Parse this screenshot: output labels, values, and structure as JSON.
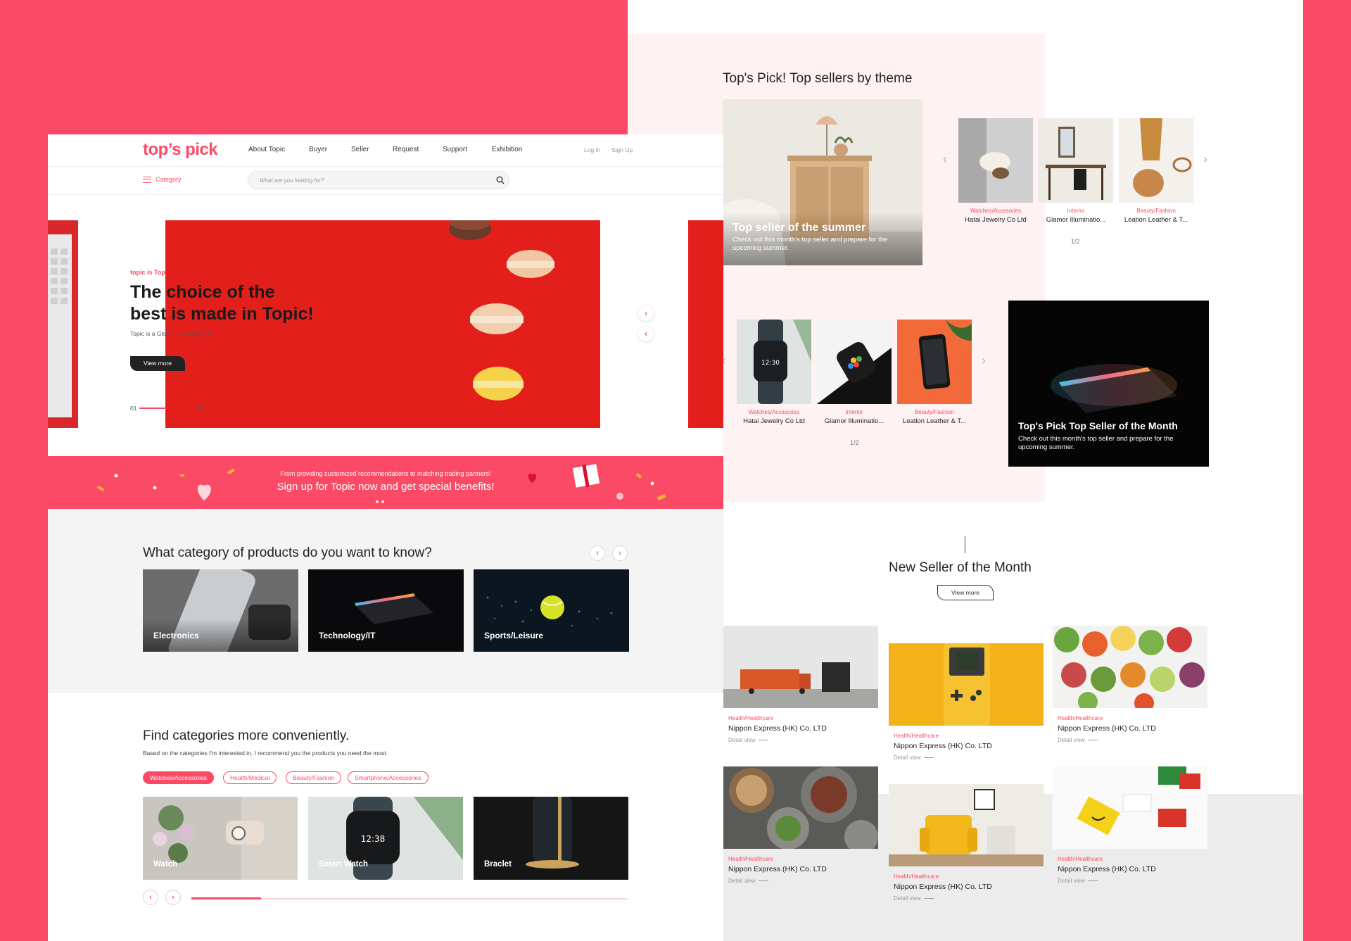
{
  "brand": {
    "logo": "top’s pick",
    "accent": "#fb4a65"
  },
  "header": {
    "nav": [
      "About Topic",
      "Buyer",
      "Seller",
      "Request",
      "Support",
      "Exhibition"
    ],
    "login": "Log in",
    "signup": "Sign Up"
  },
  "subbar": {
    "category": "Category",
    "search_placeholder": "What are you looking for?"
  },
  "hero": {
    "kicker": "topic is Top",
    "headline_1": "The choice of the",
    "headline_2": "best is made in Topic!",
    "desc": "Topic is a Glob… providing one…",
    "button": "View more",
    "page_current": "01",
    "page_total": "03"
  },
  "promo": {
    "subtitle": "From providing customized recommendations to matching trading partners!",
    "title": "Sign up for Topic now and get special benefits!"
  },
  "categories": {
    "title": "What category of products do you want to know?",
    "items": [
      "Electronics",
      "Technology/IT",
      "Sports/Leisure"
    ]
  },
  "find": {
    "title": "Find categories more conveniently.",
    "desc": "Based on the categories I'm interested in, I recommend you the products you need the most.",
    "tabs": [
      "Watches/Accessories",
      "Health/Medical",
      "Beauty/Fashion",
      "Smartphone/Accessories"
    ],
    "active_tab": 0,
    "products": [
      "Watch",
      "Smart Watch",
      "Braclet"
    ],
    "progress": 0.16
  },
  "themes": {
    "title": "Top's Pick! Top sellers by theme",
    "feature1": {
      "title": "Top seller of the summer",
      "desc": "Check out this month's top seller and prepare for the upcoming summer."
    },
    "row1": [
      {
        "cat": "Watches/Accesories",
        "name": "Hatai Jewelry Co Ltd"
      },
      {
        "cat": "Interior",
        "name": "Glamor Illuminatio..."
      },
      {
        "cat": "Beauty/Fashion",
        "name": "Leation Leather & T..."
      }
    ],
    "row1_pager": "1/2",
    "row2": [
      {
        "cat": "Watches/Accesories",
        "name": "Hatai Jewelry Co Ltd"
      },
      {
        "cat": "Interior",
        "name": "Glamor Illuminatio..."
      },
      {
        "cat": "Beauty/Fashion",
        "name": "Leation Leather & T..."
      }
    ],
    "row2_pager": "1/2",
    "feature2": {
      "title": "Top's Pick Top Seller of the Month",
      "desc": "Check out this month's top seller and prepare for the upcoming summer."
    }
  },
  "new_sellers": {
    "title": "New Seller of the Month",
    "button": "View more",
    "items": [
      {
        "cat": "Health/Healthcare",
        "name": "Nippon Express (HK) Co. LTD",
        "link": "Detail view"
      },
      {
        "cat": "Health/Healthcare",
        "name": "Nippon Express (HK) Co. LTD",
        "link": "Detail view"
      },
      {
        "cat": "Health/Healthcare",
        "name": "Nippon Express (HK) Co. LTD",
        "link": "Detail view"
      },
      {
        "cat": "Health/Healthcare",
        "name": "Nippon Express (HK) Co. LTD",
        "link": "Detail view"
      },
      {
        "cat": "Health/Healthcare",
        "name": "Nippon Express (HK) Co. LTD",
        "link": "Detail view"
      },
      {
        "cat": "Health/Healthcare",
        "name": "Nippon Express (HK) Co. LTD",
        "link": "Detail view"
      }
    ]
  }
}
